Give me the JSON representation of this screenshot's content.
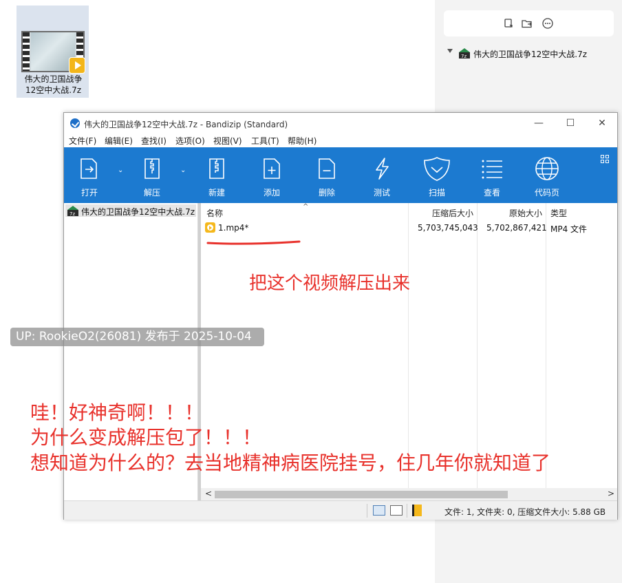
{
  "desktop_file": {
    "label": "伟大的卫国战争12空中大战.7z",
    "badge": "Player"
  },
  "explorer_panel": {
    "tree_item": "伟大的卫国战争12空中大战.7z",
    "toolbar_icons": [
      "copy-icon",
      "move-folder-icon",
      "more-icon"
    ]
  },
  "window": {
    "title": "伟大的卫国战争12空中大战.7z - Bandizip (Standard)",
    "controls": {
      "minimize": "—",
      "maximize": "☐",
      "close": "✕"
    },
    "menu": [
      "文件(F)",
      "编辑(E)",
      "查找(I)",
      "选项(O)",
      "视图(V)",
      "工具(T)",
      "帮助(H)"
    ],
    "toolbar": [
      "打开",
      "解压",
      "新建",
      "添加",
      "删除",
      "测试",
      "扫描",
      "查看",
      "代码页"
    ],
    "tree": {
      "archive": "伟大的卫国战争12空中大战.7z"
    },
    "columns": [
      "名称",
      "压缩后大小",
      "原始大小",
      "类型"
    ],
    "files": [
      {
        "name": "1.mp4*",
        "packed": "5,703,745,043",
        "size": "5,702,867,421",
        "type": "MP4 文件"
      }
    ],
    "status": "文件: 1, 文件夹: 0, 压缩文件大小: 5.88 GB",
    "colors": {
      "accent": "#1c7ad0",
      "annotation": "#e8312b"
    }
  },
  "overlays": {
    "note_top": "把这个视频解压出来",
    "up_badge": "UP: RookieO2(26081) 发布于 2025-10-04",
    "notes": [
      "哇！好神奇啊！！！",
      "为什么变成解压包了！！！",
      "想知道为什么的？去当地精神病医院挂号，住几年你就知道了"
    ]
  }
}
